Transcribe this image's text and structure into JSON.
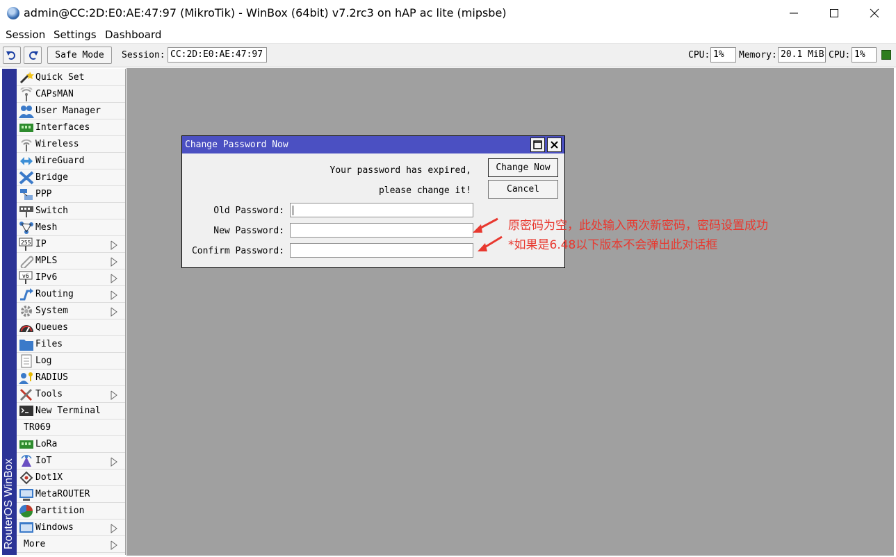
{
  "window": {
    "title": "admin@CC:2D:E0:AE:47:97 (MikroTik) - WinBox (64bit) v7.2rc3 on hAP ac lite (mipsbe)"
  },
  "menubar": {
    "items": [
      "Session",
      "Settings",
      "Dashboard"
    ]
  },
  "toolbar": {
    "safe_mode_label": "Safe Mode",
    "session_label": "Session:",
    "session_value": "CC:2D:E0:AE:47:97",
    "cpu_label": "CPU:",
    "cpu_value": "1%",
    "memory_label": "Memory:",
    "memory_value": "20.1 MiB",
    "cpu2_label": "CPU:",
    "cpu2_value": "1%",
    "status_color": "#2e7d1e"
  },
  "sidebar": {
    "brand": "RouterOS WinBox",
    "brand_color": "#2b3396",
    "items": [
      {
        "label": "Quick Set",
        "icon": "wand-icon",
        "submenu": false
      },
      {
        "label": "CAPsMAN",
        "icon": "antenna-icon",
        "submenu": false
      },
      {
        "label": "User Manager",
        "icon": "users-icon",
        "submenu": false
      },
      {
        "label": "Interfaces",
        "icon": "ethernet-icon",
        "submenu": false
      },
      {
        "label": "Wireless",
        "icon": "wireless-icon",
        "submenu": false
      },
      {
        "label": "WireGuard",
        "icon": "wireguard-icon",
        "submenu": false
      },
      {
        "label": "Bridge",
        "icon": "bridge-icon",
        "submenu": false
      },
      {
        "label": "PPP",
        "icon": "ppp-icon",
        "submenu": false
      },
      {
        "label": "Switch",
        "icon": "switch-icon",
        "submenu": false
      },
      {
        "label": "Mesh",
        "icon": "mesh-icon",
        "submenu": false
      },
      {
        "label": "IP",
        "icon": "ip-icon",
        "submenu": true
      },
      {
        "label": "MPLS",
        "icon": "mpls-icon",
        "submenu": true
      },
      {
        "label": "IPv6",
        "icon": "ipv6-icon",
        "submenu": true
      },
      {
        "label": "Routing",
        "icon": "routing-icon",
        "submenu": true
      },
      {
        "label": "System",
        "icon": "gear-icon",
        "submenu": true
      },
      {
        "label": "Queues",
        "icon": "gauge-icon",
        "submenu": false
      },
      {
        "label": "Files",
        "icon": "folder-icon",
        "submenu": false
      },
      {
        "label": "Log",
        "icon": "log-icon",
        "submenu": false
      },
      {
        "label": "RADIUS",
        "icon": "radius-icon",
        "submenu": false
      },
      {
        "label": "Tools",
        "icon": "tools-icon",
        "submenu": true
      },
      {
        "label": "New Terminal",
        "icon": "terminal-icon",
        "submenu": false
      },
      {
        "label": "TR069",
        "icon": "",
        "submenu": false
      },
      {
        "label": "LoRa",
        "icon": "lora-icon",
        "submenu": false
      },
      {
        "label": "IoT",
        "icon": "iot-icon",
        "submenu": true
      },
      {
        "label": "Dot1X",
        "icon": "dot1x-icon",
        "submenu": false
      },
      {
        "label": "MetaROUTER",
        "icon": "metarouter-icon",
        "submenu": false
      },
      {
        "label": "Partition",
        "icon": "partition-icon",
        "submenu": false
      },
      {
        "label": "Windows",
        "icon": "windows-icon",
        "submenu": true
      },
      {
        "label": "More",
        "icon": "",
        "submenu": true
      }
    ]
  },
  "dialog": {
    "title": "Change Password Now",
    "message_line1": "Your password has expired,",
    "message_line2": "please change it!",
    "change_now_label": "Change Now",
    "cancel_label": "Cancel",
    "old_password_label": "Old Password:",
    "new_password_label": "New Password:",
    "confirm_password_label": "Confirm Password:",
    "old_password_value": "",
    "new_password_value": "",
    "confirm_password_value": ""
  },
  "annotation": {
    "line1": "原密码为空，此处输入两次新密码，密码设置成功",
    "line2": "*如果是6.48以下版本不会弹出此对话框",
    "color": "#e8382f"
  }
}
